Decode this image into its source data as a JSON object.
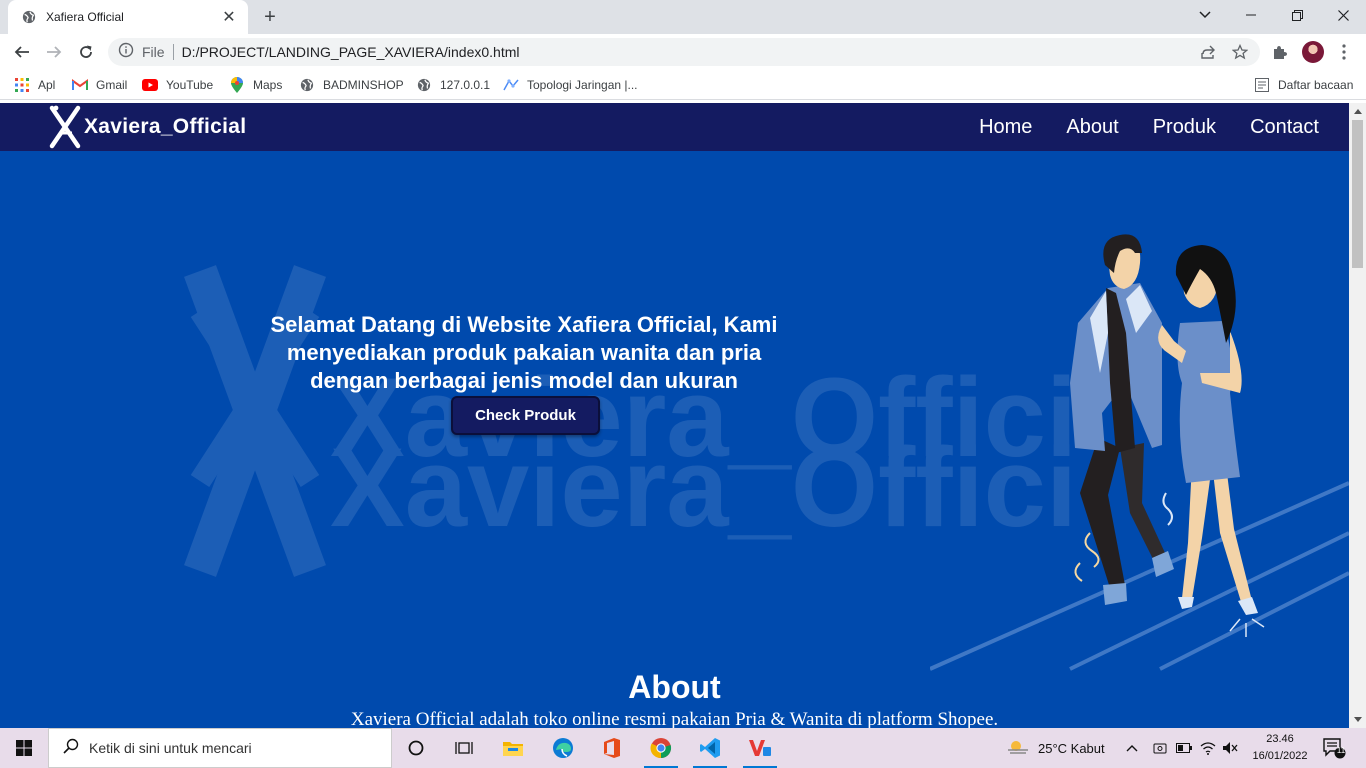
{
  "browser": {
    "tab_title": "Xafiera Official",
    "tab_close": "✕",
    "new_tab": "+",
    "window_controls": {
      "dropdown": "⌄",
      "minimize": "—",
      "restore": "❐",
      "close": "✕"
    },
    "address": {
      "scheme_label": "File",
      "url": "D:/PROJECT/LANDING_PAGE_XAVIERA/index0.html"
    },
    "bookmarks": [
      {
        "label": "Apl",
        "icon": "apps-grid-icon"
      },
      {
        "label": "Gmail",
        "icon": "gmail-icon"
      },
      {
        "label": "YouTube",
        "icon": "youtube-icon"
      },
      {
        "label": "Maps",
        "icon": "maps-icon"
      },
      {
        "label": "BADMINSHOP",
        "icon": "globe-icon"
      },
      {
        "label": "127.0.0.1",
        "icon": "globe-icon"
      },
      {
        "label": "Topologi Jaringan |...",
        "icon": "topology-icon"
      }
    ],
    "reading_list": "Daftar bacaan"
  },
  "site": {
    "brand": "Xaviera_Official",
    "nav": [
      "Home",
      "About",
      "Produk",
      "Contact"
    ],
    "hero": {
      "line1": "Selamat Datang di Website Xafiera Official, Kami",
      "line2": "menyediakan produk pakaian wanita dan pria",
      "line3": "dengan berbagai jenis model dan ukuran",
      "button": "Check Produk",
      "watermark": "Xaviera_Official"
    },
    "about": {
      "title": "About",
      "text": "Xaviera Official adalah toko online resmi pakaian Pria & Wanita di platform Shopee."
    },
    "colors": {
      "navbar": "#141b61",
      "hero_bg": "#004aad",
      "button": "#141b61"
    }
  },
  "taskbar": {
    "search_placeholder": "Ketik di sini untuk mencari",
    "weather": "25°C  Kabut",
    "time": "23.46",
    "date": "16/01/2022",
    "notifications": "11"
  }
}
